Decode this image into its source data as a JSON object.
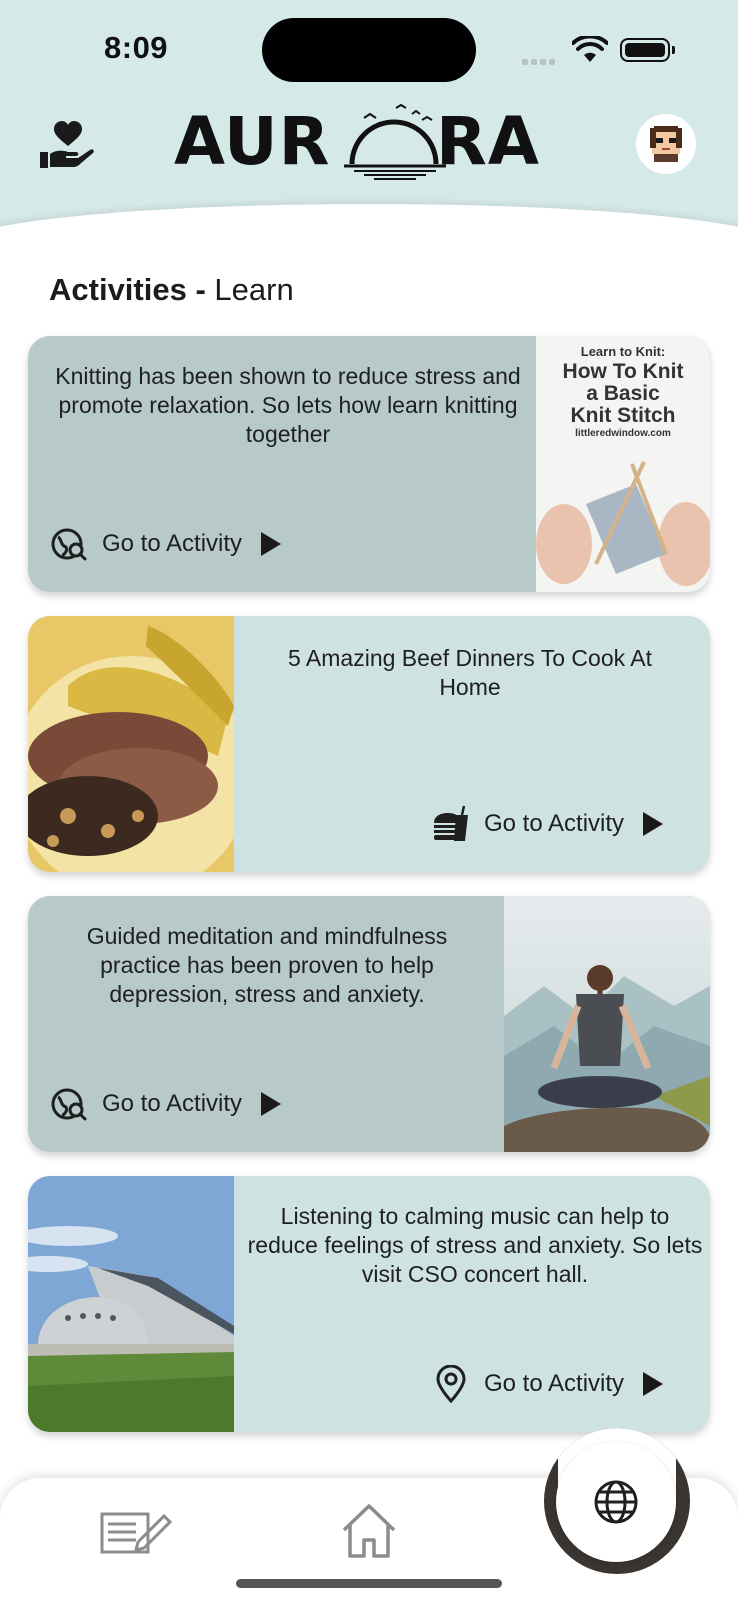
{
  "status_bar": {
    "time": "8:09"
  },
  "header": {
    "logo_text": "AURORA",
    "left_icon": "heart-in-hand-icon",
    "right_icon": "avatar"
  },
  "page": {
    "title_bold": "Activities -",
    "title_regular": "Learn"
  },
  "cards": [
    {
      "description": "Knitting has been shown to reduce stress and promote relaxation. So lets how learn knitting together",
      "action_label": "Go to Activity",
      "action_icon": "explore-search-icon",
      "image_text": {
        "line1": "Learn to Knit:",
        "line2": "How To Knit",
        "line3": "a Basic",
        "line4": "Knit Stitch",
        "line5": "littleredwindow.com"
      }
    },
    {
      "description": "5 Amazing Beef Dinners To Cook At Home",
      "action_label": "Go to Activity",
      "action_icon": "food-icon"
    },
    {
      "description": "Guided meditation and mindfulness practice has been proven to help depression, stress and anxiety.",
      "action_label": "Go to Activity",
      "action_icon": "explore-search-icon"
    },
    {
      "description": "Listening to calming music can help to reduce feelings of stress and anxiety. So lets visit CSO concert hall.",
      "action_label": "Go to Activity",
      "action_icon": "location-pin-icon"
    }
  ],
  "bottom_nav": {
    "items": [
      "journal-icon",
      "home-icon",
      "globe-icon"
    ]
  },
  "colors": {
    "header_bg": "#d6e9e9",
    "card_dark": "#b7c9c9",
    "card_light": "#cfe2e2"
  }
}
